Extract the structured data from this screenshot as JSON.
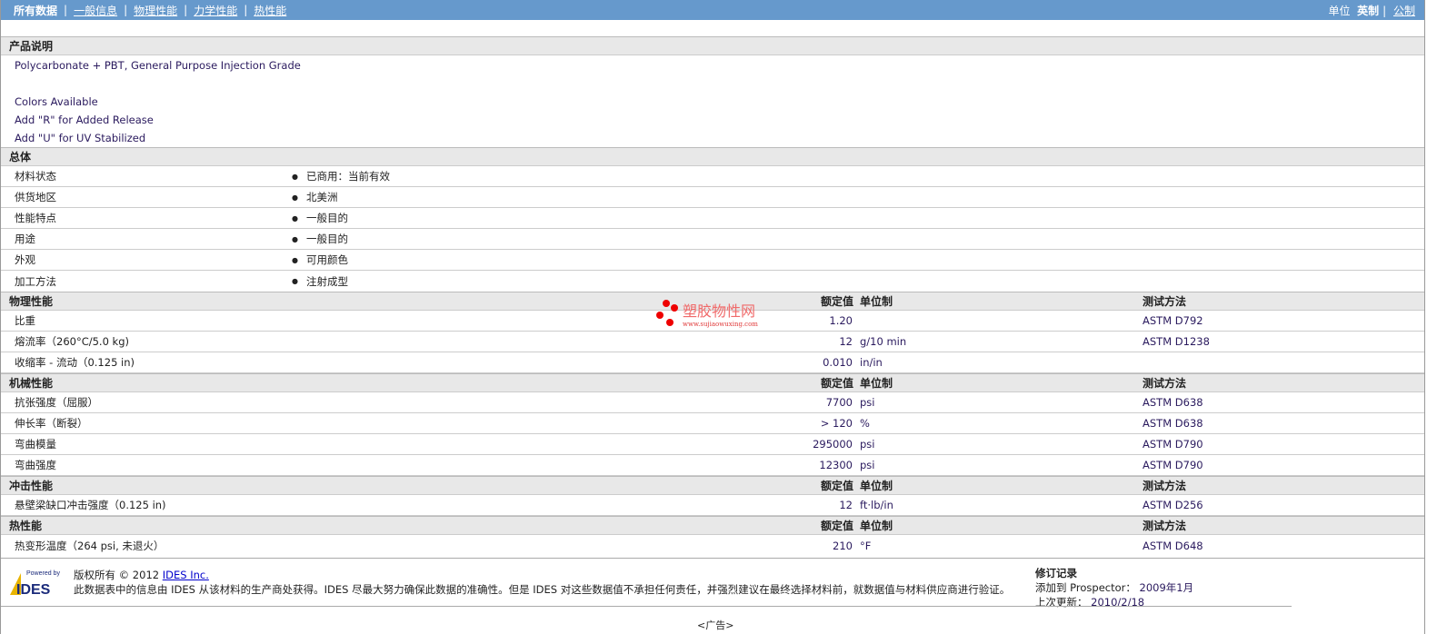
{
  "nav": {
    "items": [
      "所有数据",
      "一般信息",
      "物理性能",
      "力学性能",
      "热性能"
    ],
    "unit_label": "单位",
    "unit_en": "英制",
    "unit_metric": "公制"
  },
  "desc": {
    "title": "产品说明",
    "lines": [
      "Polycarbonate + PBT, General Purpose Injection Grade",
      "",
      "Colors Available",
      "Add \"R\" for Added Release",
      "Add \"U\" for UV Stabilized"
    ]
  },
  "general": {
    "title": "总体",
    "rows": [
      {
        "label": "材料状态",
        "value": "已商用：当前有效"
      },
      {
        "label": "供货地区",
        "value": "北美洲"
      },
      {
        "label": "性能特点",
        "value": "一般目的"
      },
      {
        "label": "用途",
        "value": "一般目的"
      },
      {
        "label": "外观",
        "value": "可用颜色"
      },
      {
        "label": "加工方法",
        "value": "注射成型"
      }
    ]
  },
  "headers": {
    "nominal": "额定值",
    "unit": "单位制",
    "method": "测试方法"
  },
  "sections": [
    {
      "title": "物理性能",
      "rows": [
        {
          "label": "比重",
          "value": "1.20",
          "unit": "",
          "method": "ASTM D792"
        },
        {
          "label": "熔流率（260°C/5.0 kg)",
          "value": "12",
          "unit": "g/10 min",
          "method": "ASTM D1238"
        },
        {
          "label": "收缩率 - 流动（0.125 in)",
          "value": "0.010",
          "unit": "in/in",
          "method": ""
        }
      ]
    },
    {
      "title": "机械性能",
      "rows": [
        {
          "label": "抗张强度（屈服）",
          "value": "7700",
          "unit": "psi",
          "method": "ASTM D638"
        },
        {
          "label": "伸长率（断裂）",
          "value": "> 120",
          "unit": "%",
          "method": "ASTM D638"
        },
        {
          "label": "弯曲模量",
          "value": "295000",
          "unit": "psi",
          "method": "ASTM D790"
        },
        {
          "label": "弯曲强度",
          "value": "12300",
          "unit": "psi",
          "method": "ASTM D790"
        }
      ]
    },
    {
      "title": "冲击性能",
      "rows": [
        {
          "label": "悬壁梁缺口冲击强度（0.125 in)",
          "value": "12",
          "unit": "ft·lb/in",
          "method": "ASTM D256"
        }
      ]
    },
    {
      "title": "热性能",
      "rows": [
        {
          "label": "热变形温度（264 psi, 未退火）",
          "value": "210",
          "unit": "°F",
          "method": "ASTM D648"
        }
      ]
    }
  ],
  "footer": {
    "logo_text": "Powered by IDES",
    "copyright": "版权所有 © 2012",
    "link": "IDES Inc.",
    "disclaimer": "此数据表中的信息由 IDES 从该材料的生产商处获得。IDES 尽最大努力确保此数据的准确性。但是 IDES 对这些数据值不承担任何责任，并强烈建议在最终选择材料前，就数据值与材料供应商进行验证。",
    "rev_title": "修订记录",
    "added_label": "添加到 Prospector：",
    "added_value": "2009年1月",
    "updated_label": "上次更新：",
    "updated_value": "2010/2/18"
  },
  "watermark": {
    "text": "塑胶物性网",
    "url": "www.sujiaowuxing.com"
  },
  "ad": "<广告>"
}
